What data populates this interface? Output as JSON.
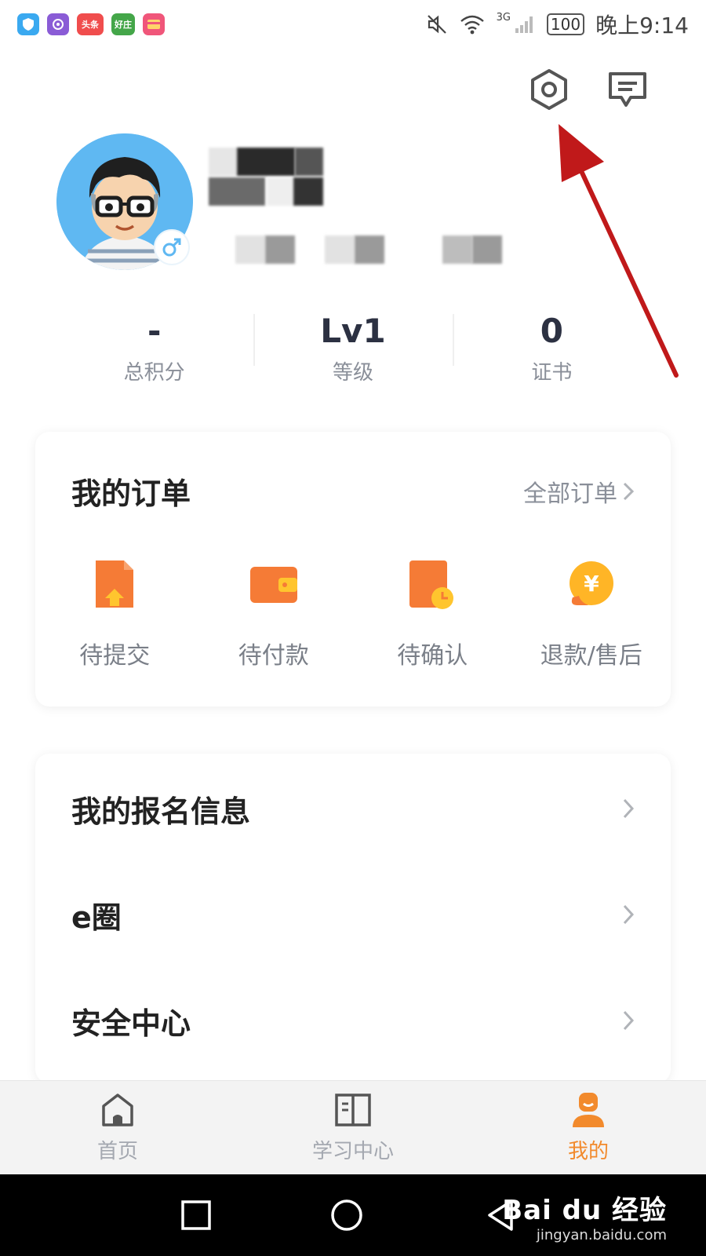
{
  "status_bar": {
    "app_icons": [
      {
        "name": "shield-app-icon",
        "color": "#3aa9f0",
        "text": ""
      },
      {
        "name": "planet-app-icon",
        "color": "#8a5cd6",
        "text": ""
      },
      {
        "name": "toutiao-app-icon",
        "color": "#f04d4d",
        "text": "头条"
      },
      {
        "name": "haozhuang-app-icon",
        "color": "#44a649",
        "text": "好庄"
      },
      {
        "name": "card-app-icon",
        "color": "#f0567a",
        "text": ""
      }
    ],
    "network": "3G",
    "battery": "100",
    "time": "晚上9:14"
  },
  "header": {
    "settings_icon": "hexagon-settings-icon",
    "message_icon": "message-icon"
  },
  "profile": {
    "gender_symbol": "♂"
  },
  "stats": [
    {
      "value": "-",
      "label": "总积分"
    },
    {
      "value": "Lv1",
      "label": "等级"
    },
    {
      "value": "0",
      "label": "证书"
    }
  ],
  "orders": {
    "title": "我的订单",
    "all_label": "全部订单",
    "items": [
      {
        "label": "待提交",
        "icon": "submit-document-icon"
      },
      {
        "label": "待付款",
        "icon": "wallet-icon"
      },
      {
        "label": "待确认",
        "icon": "clock-document-icon"
      },
      {
        "label": "退款/售后",
        "icon": "yuan-coin-icon"
      }
    ]
  },
  "menu": [
    {
      "label": "我的报名信息"
    },
    {
      "label": "e圈"
    },
    {
      "label": "安全中心"
    }
  ],
  "bottom_nav": [
    {
      "label": "首页",
      "icon": "home-icon",
      "active": false
    },
    {
      "label": "学习中心",
      "icon": "book-icon",
      "active": false
    },
    {
      "label": "我的",
      "icon": "person-icon",
      "active": true
    }
  ],
  "watermark": {
    "main": "Bai du 经验",
    "sub": "jingyan.baidu.com"
  },
  "colors": {
    "accent_orange": "#f28a2c",
    "annotation_red": "#c0191a",
    "avatar_blue": "#5fb8f2"
  }
}
